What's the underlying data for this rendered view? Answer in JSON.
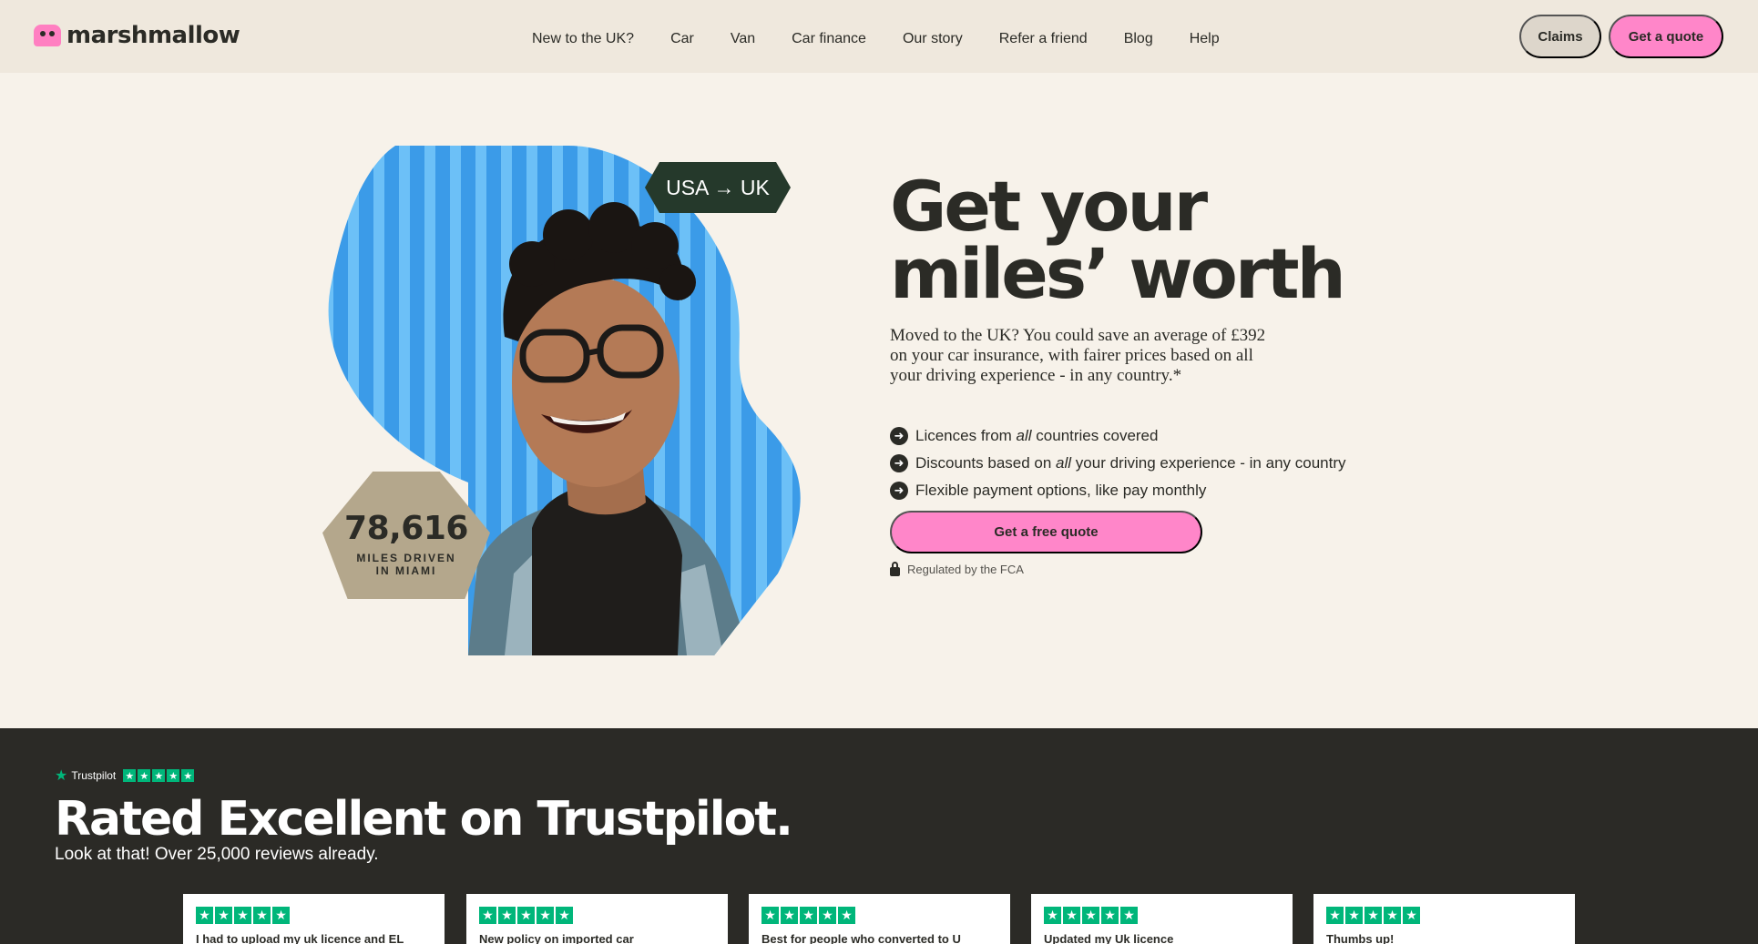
{
  "brand": {
    "name": "marshmallow",
    "accent": "#ff86c9",
    "dark": "#2b2b26"
  },
  "nav": {
    "items": [
      "New to the UK?",
      "Car",
      "Van",
      "Car finance",
      "Our story",
      "Refer a friend",
      "Blog",
      "Help"
    ],
    "claims_label": "Claims",
    "quote_label": "Get a quote"
  },
  "hero": {
    "tag": "USA → UK",
    "miles_value": "78,616",
    "miles_caption": "MILES DRIVEN IN MIAMI",
    "headline": "Get your miles’ worth",
    "intro": "Moved to the UK? You could save an average of £392 on your car insurance, with fairer prices based on all your driving experience - in any country.*",
    "benefits": [
      {
        "before": "Licences from ",
        "em": "all",
        "after": " countries covered"
      },
      {
        "before": "Discounts based on ",
        "em": "all",
        "after": " your driving experience - in any country"
      },
      {
        "before": "Flexible payment options, like pay monthly",
        "em": "",
        "after": ""
      }
    ],
    "cta_label": "Get a free quote",
    "regulated_text": "Regulated by the FCA"
  },
  "trustpilot": {
    "brand_label": "Trustpilot",
    "title": "Rated Excellent on Trustpilot.",
    "subtitle": "Look at that! Over 25,000 reviews already.",
    "rating_stars": 5,
    "reviews": [
      {
        "stars": 5,
        "text": "I had to upload my uk licence and EL"
      },
      {
        "stars": 5,
        "text": "New policy on imported car"
      },
      {
        "stars": 5,
        "text": "Best for people who converted to U"
      },
      {
        "stars": 5,
        "text": "Updated my Uk licence"
      },
      {
        "stars": 5,
        "text": "Thumbs up!"
      }
    ]
  }
}
